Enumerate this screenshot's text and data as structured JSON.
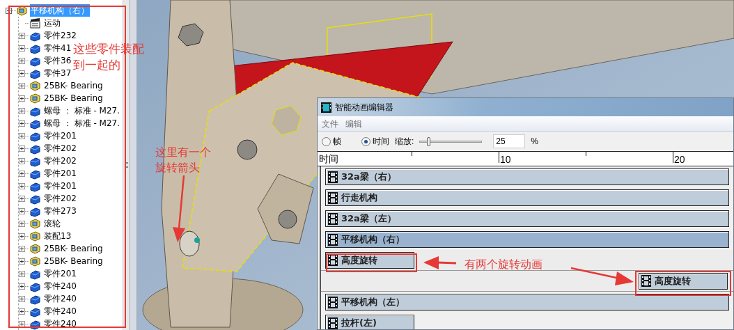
{
  "tree": {
    "label": "平移机构（右）",
    "kind": "assembly",
    "selected": true,
    "expanded": true,
    "children": [
      {
        "label": "运动",
        "kind": "motion",
        "selected": false
      },
      {
        "label": "零件232",
        "kind": "part",
        "selected": false,
        "expanded": false
      },
      {
        "label": "零件41",
        "kind": "part",
        "selected": false,
        "expanded": false
      },
      {
        "label": "零件36",
        "kind": "part",
        "selected": false,
        "expanded": false
      },
      {
        "label": "零件37",
        "kind": "part",
        "selected": false,
        "expanded": false
      },
      {
        "label": "25BK- Bearing",
        "kind": "assembly",
        "selected": false,
        "expanded": false
      },
      {
        "label": "25BK- Bearing",
        "kind": "assembly",
        "selected": false,
        "expanded": false
      },
      {
        "label": "螺母 ： 标准 - M27.",
        "kind": "part",
        "selected": false,
        "expanded": false
      },
      {
        "label": "螺母 ： 标准 - M27.",
        "kind": "part",
        "selected": false,
        "expanded": false
      },
      {
        "label": "零件201",
        "kind": "part",
        "selected": false,
        "expanded": false
      },
      {
        "label": "零件202",
        "kind": "part",
        "selected": false,
        "expanded": false
      },
      {
        "label": "零件202",
        "kind": "part",
        "selected": false,
        "expanded": false
      },
      {
        "label": "零件201",
        "kind": "part",
        "selected": false,
        "expanded": false
      },
      {
        "label": "零件201",
        "kind": "part",
        "selected": false,
        "expanded": false
      },
      {
        "label": "零件202",
        "kind": "part",
        "selected": false,
        "expanded": false
      },
      {
        "label": "零件273",
        "kind": "part",
        "selected": false,
        "expanded": false
      },
      {
        "label": "滚轮",
        "kind": "assembly",
        "selected": false,
        "expanded": false
      },
      {
        "label": "装配13",
        "kind": "assembly",
        "selected": false,
        "expanded": false
      },
      {
        "label": "25BK- Bearing",
        "kind": "assembly",
        "selected": false,
        "expanded": false
      },
      {
        "label": "25BK- Bearing",
        "kind": "assembly",
        "selected": false,
        "expanded": false
      },
      {
        "label": "零件201",
        "kind": "part",
        "selected": false,
        "expanded": false
      },
      {
        "label": "零件240",
        "kind": "part",
        "selected": false,
        "expanded": false
      },
      {
        "label": "零件240",
        "kind": "part",
        "selected": false,
        "expanded": false
      },
      {
        "label": "零件240",
        "kind": "part",
        "selected": false,
        "expanded": false
      },
      {
        "label": "零件240",
        "kind": "part",
        "selected": false,
        "expanded": false
      }
    ]
  },
  "editor": {
    "title": "智能动画编辑器",
    "menu": [
      "文件",
      "编辑"
    ],
    "modes": [
      {
        "label": "帧",
        "selected": false
      },
      {
        "label": "时间",
        "selected": true
      }
    ],
    "zoom": {
      "label": "缩放:",
      "level": 0.12,
      "value": "25",
      "unit": "%"
    },
    "ruler": {
      "label": "时间",
      "ticks": [
        "10",
        "20"
      ]
    },
    "tracks": [
      {
        "label": "32a梁（右）",
        "kind": "full",
        "selected": false
      },
      {
        "label": "行走机构",
        "kind": "full",
        "selected": false
      },
      {
        "label": "32a梁（左）",
        "kind": "full",
        "selected": false
      },
      {
        "label": "平移机构（右）",
        "kind": "full",
        "selected": true
      },
      {
        "label": "高度旋转",
        "kind": "start",
        "selected": false
      },
      {
        "label": "高度旋转",
        "kind": "end",
        "selected": false
      },
      {
        "label": "平移机构（左）",
        "kind": "full",
        "selected": false
      },
      {
        "label": "拉杆(左)",
        "kind": "start",
        "selected": false
      }
    ]
  },
  "annotations": [
    {
      "lines": [
        "这些零件装配",
        "到一起的"
      ]
    },
    {
      "lines": [
        "这里有一个",
        "旋转箭头"
      ]
    },
    {
      "lines": [
        "有两个旋转动画"
      ]
    }
  ]
}
